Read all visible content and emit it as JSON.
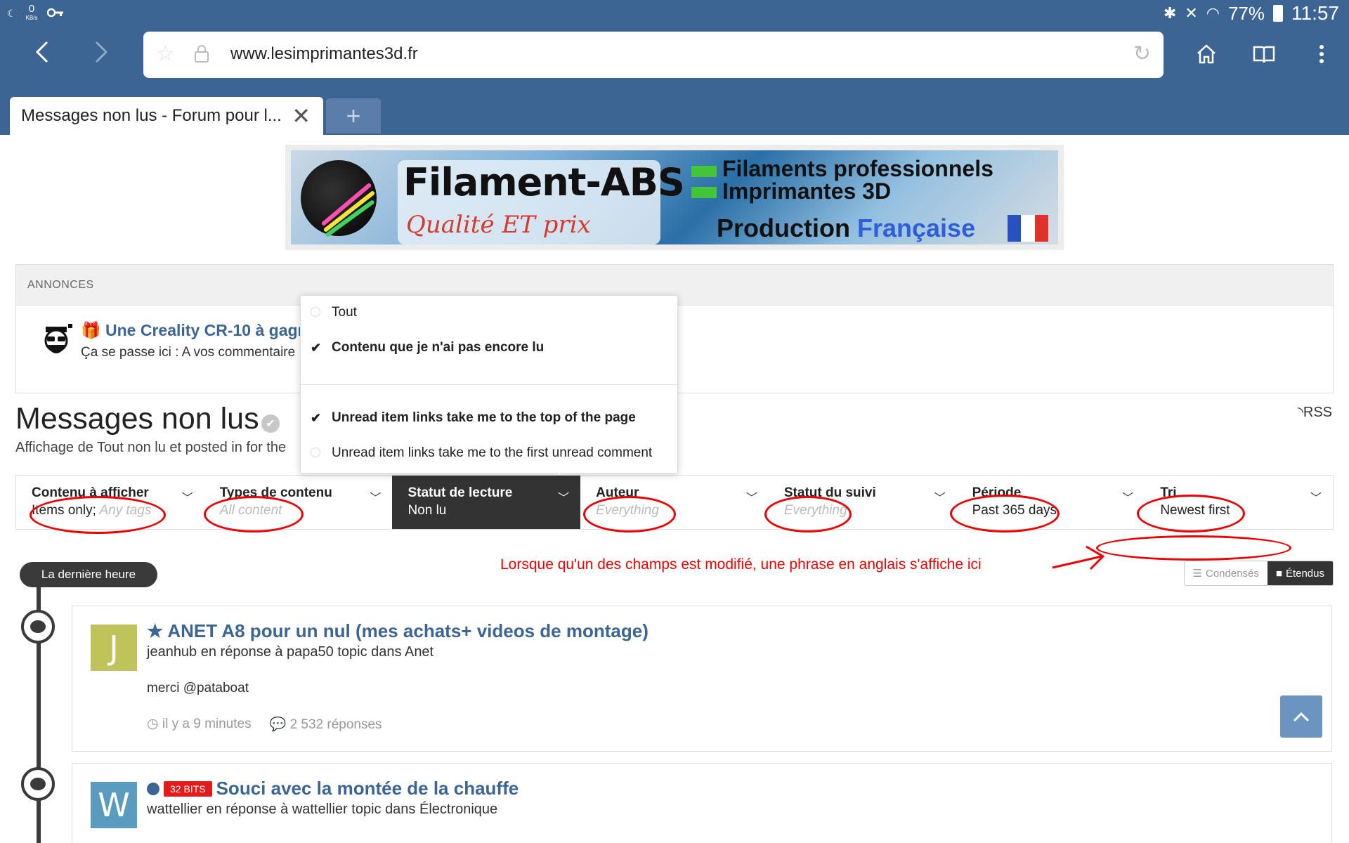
{
  "status_bar": {
    "kbs_value": "0",
    "kbs_unit": "KB/s",
    "battery": "77%",
    "time": "11:57"
  },
  "browser": {
    "url": "www.lesimprimantes3d.fr",
    "tab_title": "Messages non lus - Forum pour l...",
    "new_tab": "+"
  },
  "banner": {
    "brand": "Filament-ABS",
    "tagline": "Qualité ET prix",
    "line1": "Filaments professionnels",
    "line2": "Imprimantes 3D",
    "production": "Production ",
    "production_fr": "Française"
  },
  "announcements": {
    "header": "ANNONCES",
    "title": "🎁 Une Creality CR-10 à gagr",
    "subtitle": "Ça se passe ici : A vos commentaire"
  },
  "page": {
    "title": "Messages non lus",
    "subtitle": "Affichage de Tout non lu et posted in for the",
    "rss": "RSS"
  },
  "read_status_menu": {
    "items": [
      {
        "label": "Tout",
        "checked": false
      },
      {
        "label": "Contenu que je n'ai pas encore lu",
        "checked": true
      },
      {
        "label": "Unread item links take me to the top of the page",
        "checked": true
      },
      {
        "label": "Unread item links take me to the first unread comment",
        "checked": false
      }
    ]
  },
  "filters": [
    {
      "label": "Contenu à afficher",
      "value": "Items only;",
      "placeholder": " Any tags"
    },
    {
      "label": "Types de contenu",
      "value": "",
      "placeholder": "All content"
    },
    {
      "label": "Statut de lecture",
      "value": "Non lu",
      "placeholder": ""
    },
    {
      "label": "Auteur",
      "value": "",
      "placeholder": "Everything"
    },
    {
      "label": "Statut du suivi",
      "value": "",
      "placeholder": "Everything"
    },
    {
      "label": "Période",
      "value": "Past 365 days",
      "placeholder": ""
    },
    {
      "label": "Tri",
      "value": "Newest first",
      "placeholder": ""
    }
  ],
  "annotation": {
    "note": "Lorsque qu'un des champs est modifié, une phrase en anglais s'affiche ici"
  },
  "stream": {
    "time_group": "La dernière heure",
    "view_condensed": "Condensés",
    "view_expanded": "Étendus",
    "items": [
      {
        "avatar_letter": "J",
        "title": "ANET A8 pour un nul (mes achats+ videos de montage)",
        "meta": "jeanhub en réponse à papa50 topic dans Anet",
        "body": "merci @pataboat",
        "time": "il y a 9 minutes",
        "replies": "2 532 réponses"
      },
      {
        "avatar_letter": "W",
        "badge": "32 BITS",
        "title": "Souci avec la montée de la chauffe",
        "meta": "wattellier en réponse à wattellier topic dans Électronique"
      }
    ]
  },
  "colors": {
    "brand_blue": "#3d6593",
    "annotation_red": "#e00000",
    "badge_red": "#e51a1a"
  }
}
